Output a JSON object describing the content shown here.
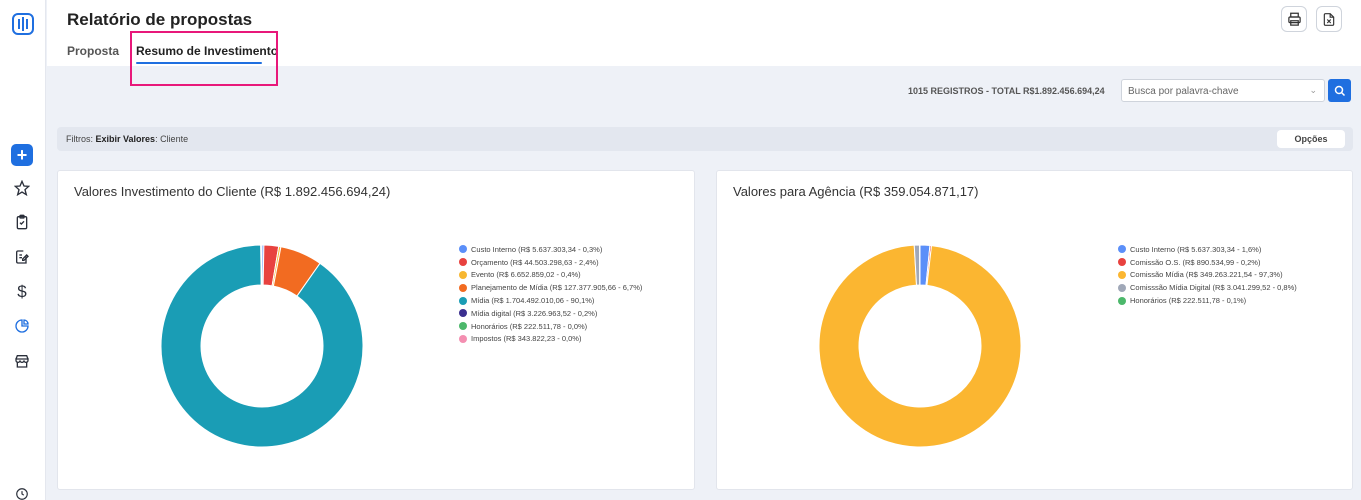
{
  "header": {
    "title": "Relatório de propostas",
    "tabs": [
      {
        "label": "Proposta"
      },
      {
        "label": "Resumo de Investimento",
        "active": true
      }
    ],
    "print_icon": "printer-icon",
    "export_icon": "excel-export-icon"
  },
  "sidebar": {
    "icons": [
      "logo-icon",
      "plus-icon",
      "star-icon",
      "clipboard-check-icon",
      "edit-document-icon",
      "dollar-icon",
      "pie-chart-icon",
      "store-icon",
      "clock-icon"
    ]
  },
  "toolbar": {
    "total_text": "1015 REGISTROS - TOTAL R$1.892.456.694,24",
    "search_placeholder": "Busca por palavra-chave"
  },
  "filters": {
    "prefix": "Filtros:",
    "key": "Exibir Valores",
    "value": ": Cliente",
    "options_label": "Opções"
  },
  "charts": {
    "left": {
      "title": "Valores Investimento do Cliente (R$ 1.892.456.694,24)",
      "legend": [
        "Custo Interno (R$ 5.637.303,34 - 0,3%)",
        "Orçamento (R$ 44.503.298,63 - 2,4%)",
        "Evento (R$ 6.652.859,02 - 0,4%)",
        "Planejamento de Mídia (R$ 127.377.905,66 - 6,7%)",
        "Mídia (R$ 1.704.492.010,06 - 90,1%)",
        "Mídia digital (R$ 3.226.963,52 - 0,2%)",
        "Honorários (R$ 222.511,78 - 0,0%)",
        "Impostos (R$ 343.822,23 - 0,0%)"
      ]
    },
    "right": {
      "title": "Valores para Agência (R$ 359.054.871,17)",
      "legend": [
        "Custo Interno (R$ 5.637.303,34 - 1,6%)",
        "Comissão O.S. (R$ 890.534,99 - 0,2%)",
        "Comissão Mídia (R$ 349.263.221,54 - 97,3%)",
        "Comisssão Mídia Digital (R$ 3.041.299,52 - 0,8%)",
        "Honorários (R$ 222.511,78 - 0,1%)"
      ]
    }
  },
  "chart_data": [
    {
      "type": "pie",
      "title": "Valores Investimento do Cliente (R$ 1.892.456.694,24)",
      "categories": [
        "Custo Interno",
        "Orçamento",
        "Evento",
        "Planejamento de Mídia",
        "Mídia",
        "Mídia digital",
        "Honorários",
        "Impostos"
      ],
      "values": [
        5637303.34,
        44503298.63,
        6652859.02,
        127377905.66,
        1704492010.06,
        3226963.52,
        222511.78,
        343822.23
      ],
      "colors": [
        "#5b8ff9",
        "#e8423f",
        "#f7b731",
        "#f26b21",
        "#1a9db5",
        "#3b2f8f",
        "#4cb86b",
        "#f48fb1"
      ],
      "legend": "right"
    },
    {
      "type": "pie",
      "title": "Valores para Agência (R$ 359.054.871,17)",
      "categories": [
        "Custo Interno",
        "Comissão O.S.",
        "Comissão Mídia",
        "Comisssão Mídia Digital",
        "Honorários"
      ],
      "values": [
        5637303.34,
        890534.99,
        349263221.54,
        3041299.52,
        222511.78
      ],
      "colors": [
        "#5b8ff9",
        "#e8423f",
        "#fbb631",
        "#a0a8b8",
        "#4cb86b"
      ],
      "legend": "right"
    }
  ]
}
